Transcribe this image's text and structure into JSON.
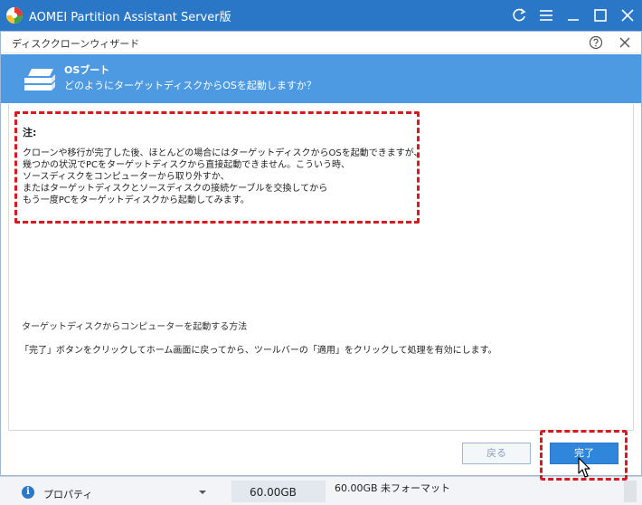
{
  "app": {
    "title": "AOMEI Partition Assistant Server版"
  },
  "dialog": {
    "title": "ディスククローンウィザード",
    "step_title": "OSブート",
    "step_subtitle": "どのようにターゲットディスクからOSを起動しますか？",
    "note_heading": "注:",
    "note_lines": [
      "クローンや移行が完了した後、ほとんどの場合にはターゲットディスクからOSを起動できますが、",
      "幾つかの状況でPCをターゲットディスクから直接起動できません。こういう時、",
      "ソースディスクをコンピューターから取り外すか、",
      "またはターゲットディスクとソースディスクの接続ケーブルを交換してから",
      "もう一度PCをターゲットディスクから起動してみます。"
    ],
    "boot_method_label": "ターゲットディスクからコンピューターを起動する方法",
    "finish_instruction": "「完了」ボタンをクリックしてホーム画面に戻ってから、ツールバーの「適用」をクリックして処理を有効にします。",
    "back_label": "戻る",
    "finish_label": "完了"
  },
  "background": {
    "properties_label": "プロパティ",
    "capacity": "60.00GB",
    "unformatted": "60.00GB 未フォーマット"
  },
  "colors": {
    "titlebar": "#2a77c8",
    "header": "#4d9ae2",
    "highlight": "#d71920",
    "finish_button": "#2f86db"
  },
  "icons": [
    "app-logo-icon",
    "refresh-icon",
    "menu-icon",
    "minimize-icon",
    "maximize-icon",
    "close-icon",
    "help-icon",
    "disk-icon",
    "info-icon",
    "chevron-down-icon",
    "cursor-icon"
  ]
}
